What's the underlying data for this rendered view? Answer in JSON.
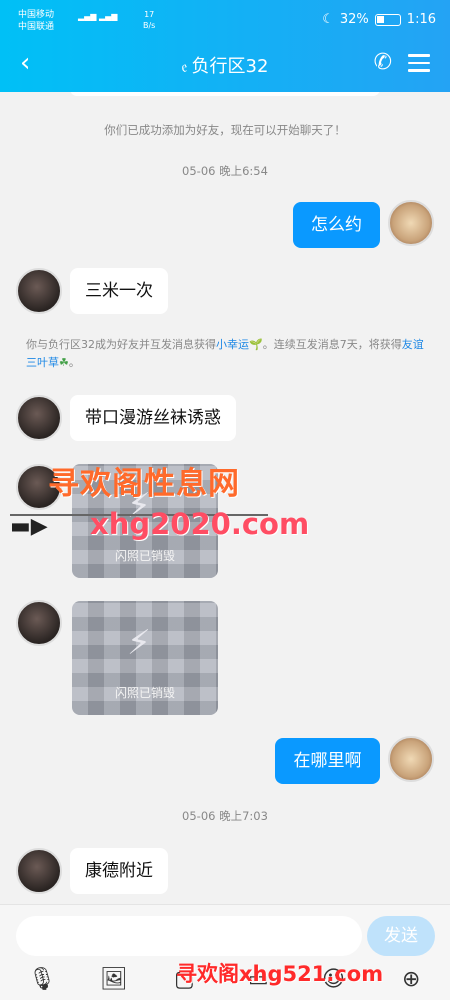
{
  "status": {
    "carrier1": "中国移动",
    "carrier2": "中国联通",
    "speed_value": "17",
    "speed_unit": "B/s",
    "battery": "32%",
    "time": "1:16"
  },
  "header": {
    "title": "负行区32",
    "back_icon": "chevron-left-icon",
    "call_icon": "phone-icon",
    "menu_icon": "menu-icon"
  },
  "chat": {
    "friend_added": "你们已成功添加为好友，现在可以开始聊天了！",
    "time1": "05-06 晚上6:54",
    "msg_out1": "怎么约",
    "msg_in1": "三米一次",
    "notice_part1": "你与负行区32成为好友并互发消息获得",
    "notice_link1": "小幸运",
    "notice_part2": "。连续互发消息7天，将获得",
    "notice_link2": "友谊三叶草",
    "notice_part3": "。",
    "msg_in2": "带口漫游丝袜诱惑",
    "photo1_caption": "闪照已销毁",
    "photo2_caption": "闪照已销毁",
    "msg_out2": "在哪里啊",
    "time2": "05-06 晚上7:03",
    "msg_in3": "康德附近"
  },
  "watermark": {
    "line1": "寻欢阁性息网",
    "line2": "xhg2020.com",
    "line3": "寻欢阁xhg521.com"
  },
  "input": {
    "placeholder": "",
    "send_label": "发送"
  },
  "colors": {
    "header_start": "#00c0f6",
    "header_end": "#24a3f4",
    "bubble_out": "#0a99ff",
    "send_disabled": "#bfe2fb",
    "link_blue": "#1e88e5"
  }
}
